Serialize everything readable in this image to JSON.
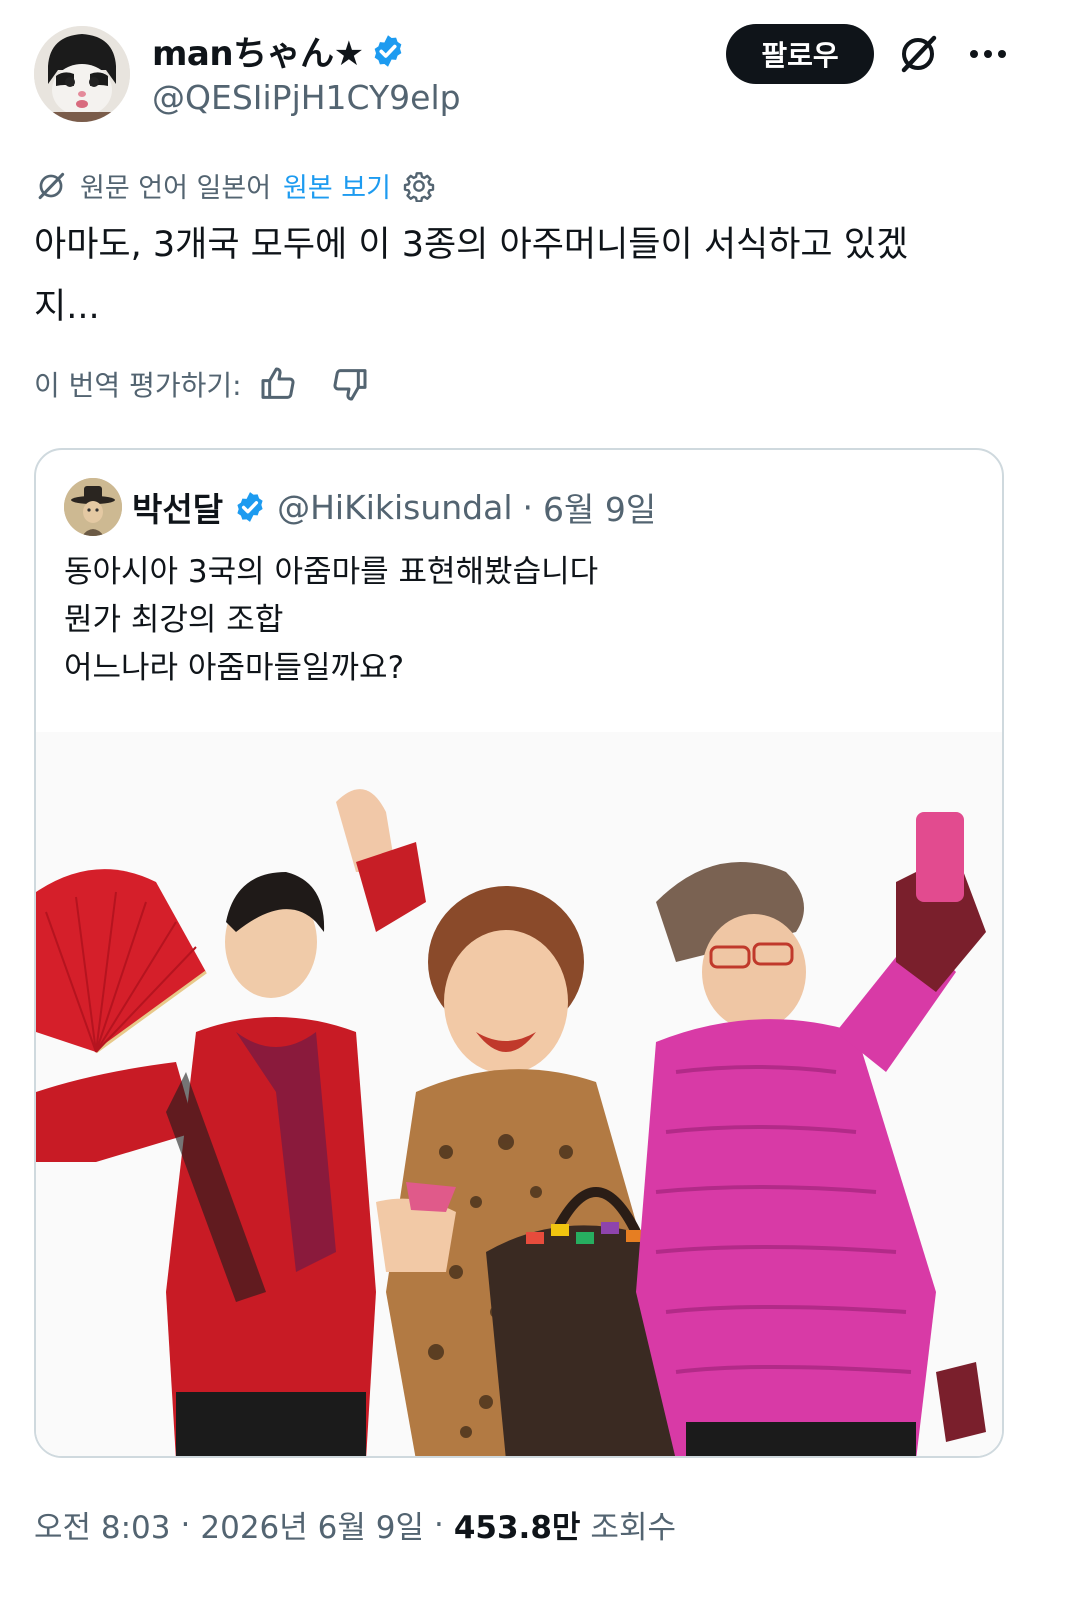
{
  "author": {
    "display_name": "manちゃん★",
    "handle": "@QESIiPjH1CY9elp",
    "verified_icon": "verified-badge-icon",
    "avatar_icon": "cat-avatar-icon"
  },
  "actions": {
    "follow_label": "팔로우",
    "grok_icon": "grok-icon",
    "more_icon": "more-dots-icon"
  },
  "translation": {
    "source_label": "원문 언어 일본어",
    "show_original_label": "원본 보기",
    "settings_icon": "gear-icon"
  },
  "post": {
    "text": "아마도, 3개국 모두에 이 3종의 아주머니들이 서식하고 있겠\n지..."
  },
  "rating": {
    "label": "이 번역 평가하기:",
    "like_icon": "thumbs-up-icon",
    "dislike_icon": "thumbs-down-icon"
  },
  "quote": {
    "display_name": "박선달",
    "handle": "@HiKikisundal",
    "separator": "·",
    "date": "6월 9일",
    "text": "동아시아 3국의 아줌마를 표현해봤습니다\n뭔가 최강의 조합\n어느나라 아줌마들일까요?",
    "image_icon": "three-women-photo"
  },
  "footer": {
    "time": "오전 8:03",
    "sep1": "·",
    "date": "2026년 6월 9일",
    "sep2": "·",
    "views_count": "453.8만",
    "views_label": "조회수"
  },
  "colors": {
    "text": "#0f1419",
    "secondary": "#536471",
    "link": "#1d9bf0",
    "border": "#cfd9de",
    "button_bg": "#0f1419"
  }
}
